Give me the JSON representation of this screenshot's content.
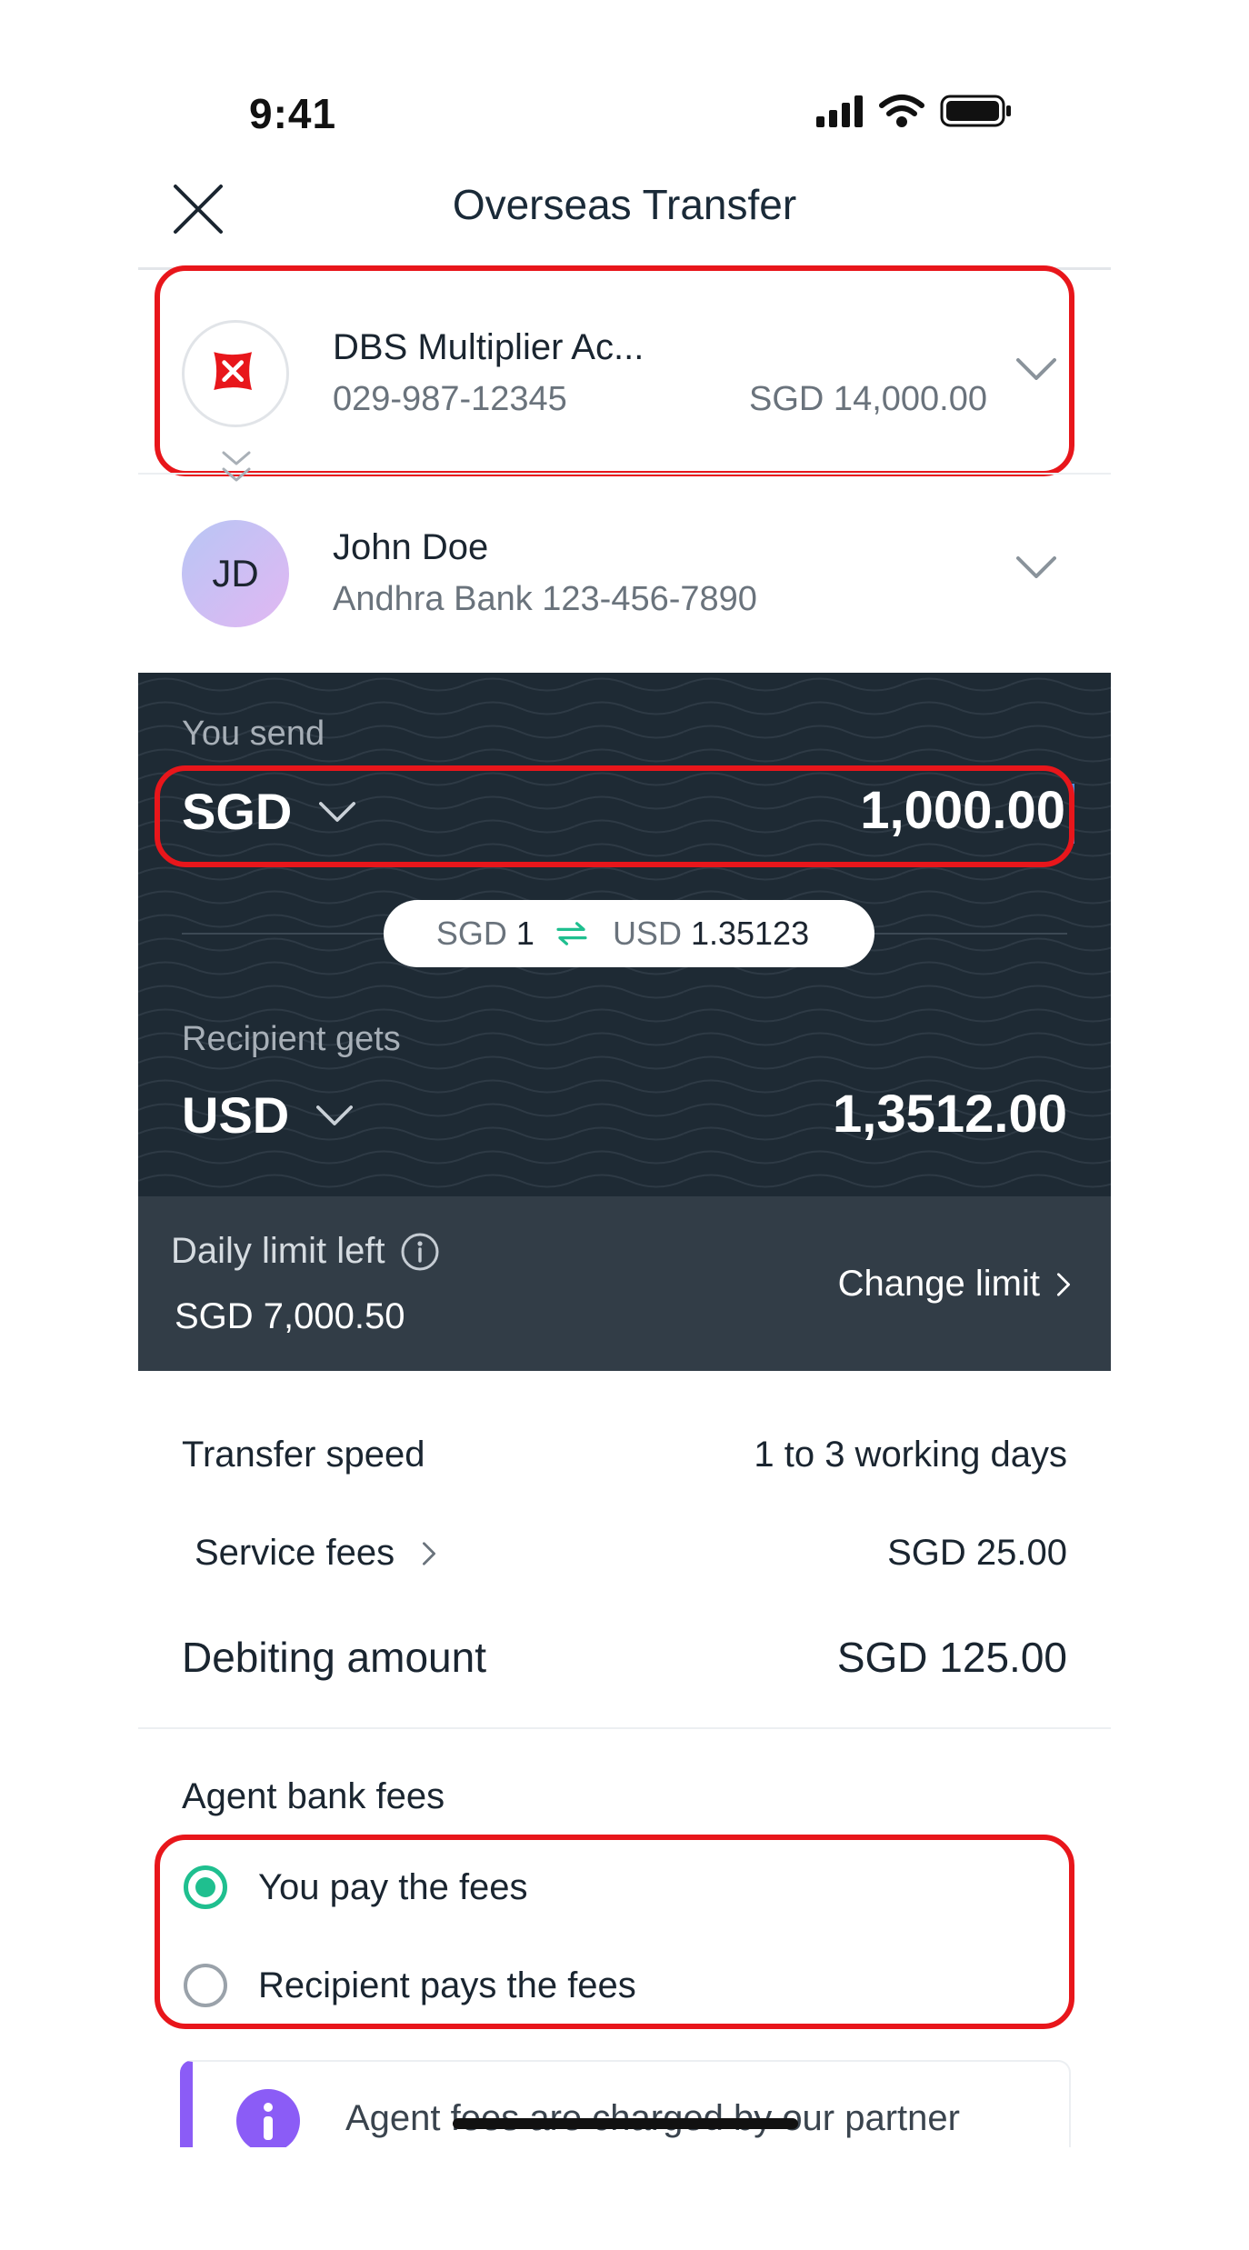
{
  "status_bar": {
    "time": "9:41"
  },
  "header": {
    "title": "Overseas Transfer"
  },
  "from_account": {
    "name": "DBS Multiplier Ac...",
    "number": "029-987-12345",
    "balance": "SGD 14,000.00"
  },
  "recipient": {
    "initials": "JD",
    "name": "John Doe",
    "bank": "Andhra Bank 123-456-7890"
  },
  "send": {
    "label": "You send",
    "currency": "SGD",
    "amount": "1,000.00"
  },
  "rate": {
    "from_currency": "SGD",
    "from_value": "1",
    "to_currency": "USD",
    "to_value": "1.35123"
  },
  "receive": {
    "label": "Recipient gets",
    "currency": "USD",
    "amount": "1,3512.00"
  },
  "limit": {
    "label": "Daily limit left",
    "value": "SGD 7,000.50",
    "change_label": "Change limit"
  },
  "details": {
    "speed_label": "Transfer speed",
    "speed_value": "1 to 3 working days",
    "service_label": "Service fees",
    "service_value": "SGD 25.00",
    "debit_label": "Debiting amount",
    "debit_value": "SGD 125.00"
  },
  "agent_fees": {
    "title": "Agent bank fees",
    "options": [
      {
        "label": "You pay the fees",
        "selected": true
      },
      {
        "label": "Recipient pays the fees",
        "selected": false
      }
    ]
  },
  "info": {
    "text": "Agent fees are charged by our partner"
  },
  "colors": {
    "accent_green": "#1fbf8f",
    "highlight_red": "#e8161b",
    "dark_panel": "#1e2a34",
    "info_purple": "#8b5cf6"
  }
}
